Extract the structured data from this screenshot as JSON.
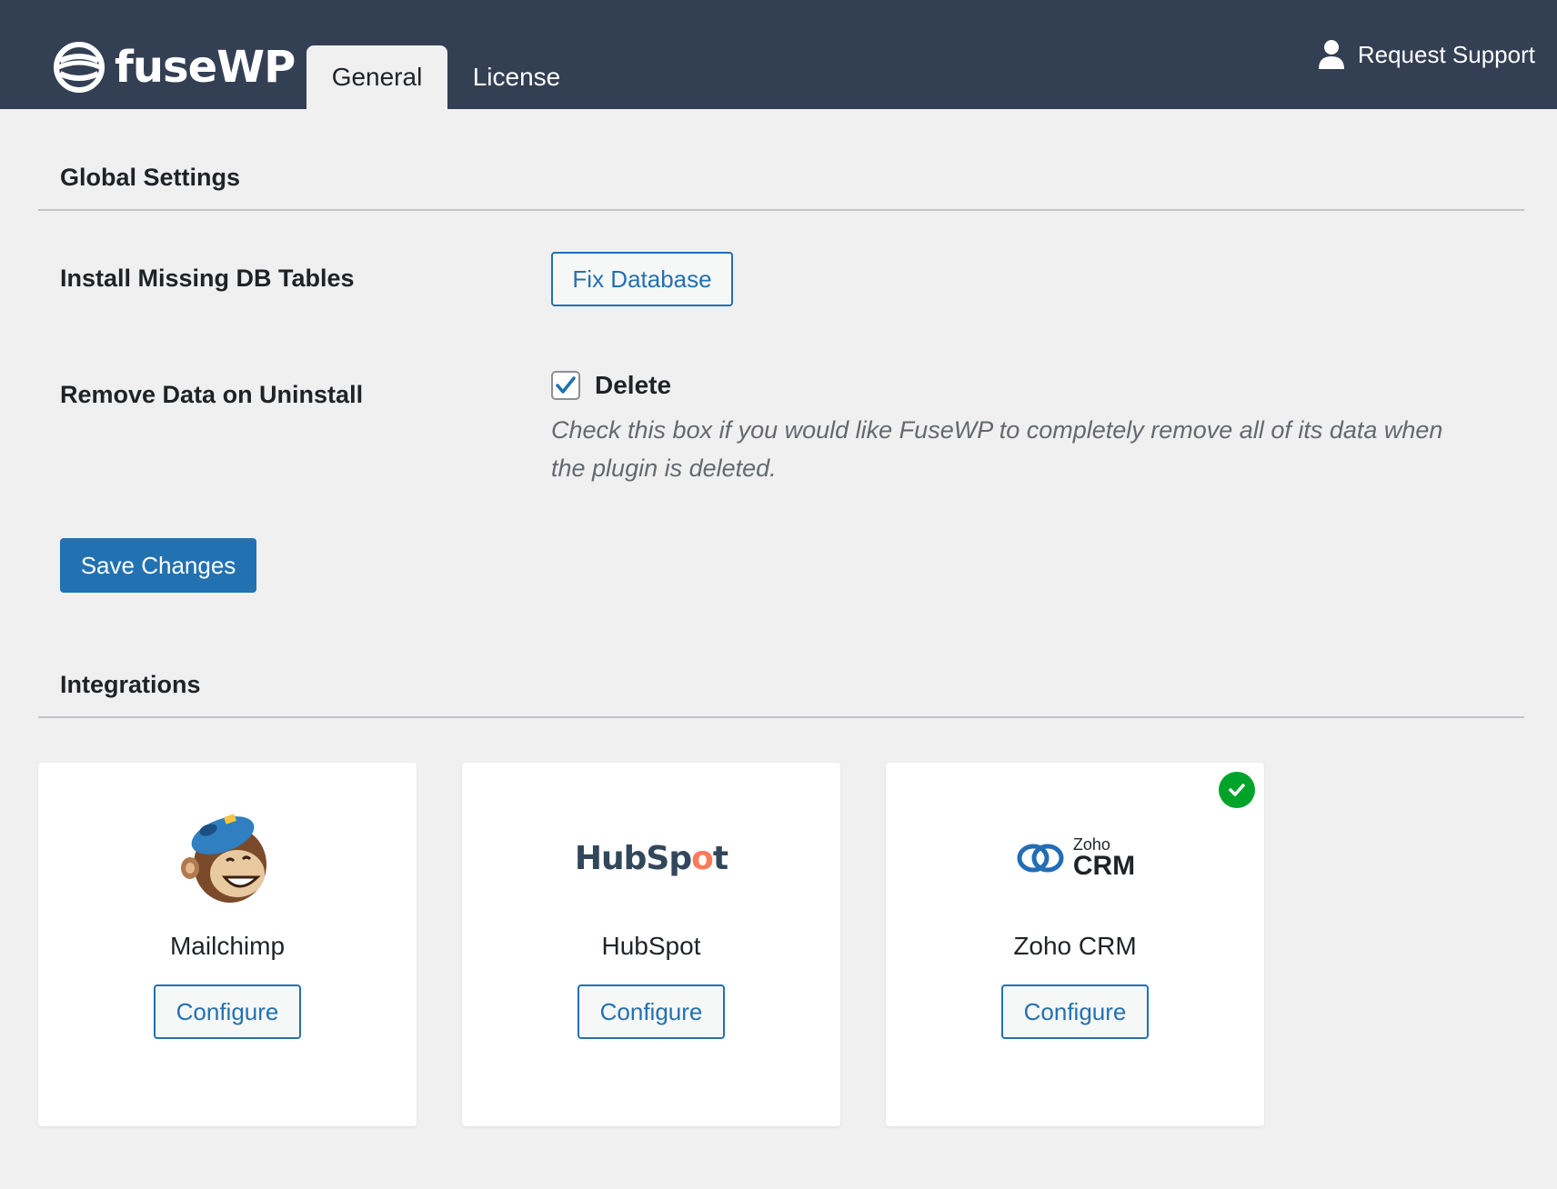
{
  "header": {
    "logo_text": "fuseWP",
    "tabs": [
      {
        "label": "General",
        "active": true
      },
      {
        "label": "License",
        "active": false
      }
    ],
    "support_label": "Request Support",
    "bg_color": "#333f53"
  },
  "global_settings": {
    "title": "Global Settings",
    "install_db": {
      "label": "Install Missing DB Tables",
      "button_label": "Fix Database"
    },
    "remove_data": {
      "label": "Remove Data on Uninstall",
      "checkbox_label": "Delete",
      "checked": true,
      "description": "Check this box if you would like FuseWP to completely remove all of its data when the plugin is deleted."
    },
    "save_label": "Save Changes"
  },
  "integrations": {
    "title": "Integrations",
    "items": [
      {
        "name": "Mailchimp",
        "button_label": "Configure",
        "connected": false,
        "icon": "mailchimp-logo"
      },
      {
        "name": "HubSpot",
        "button_label": "Configure",
        "connected": false,
        "logo_text_a": "HubSp",
        "logo_text_b": "o",
        "logo_text_c": "t",
        "icon": "hubspot-logo"
      },
      {
        "name": "Zoho CRM",
        "button_label": "Configure",
        "connected": true,
        "logo_small": "Zoho",
        "logo_big": "CRM",
        "icon": "zoho-crm-logo"
      }
    ]
  },
  "colors": {
    "primary": "#2271b1",
    "success": "#00a32a",
    "background": "#f0f0f1"
  }
}
